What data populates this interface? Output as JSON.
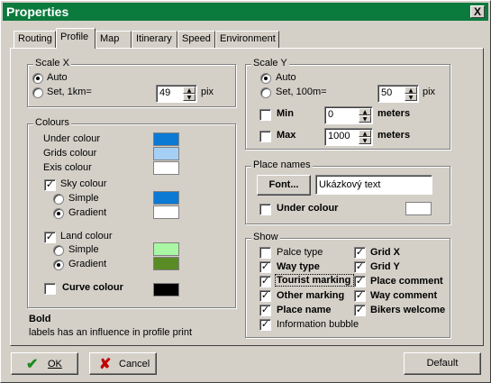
{
  "window": {
    "title": "Properties",
    "close_glyph": "X"
  },
  "tabs": [
    "Routing",
    "Profile",
    "Map",
    "Itinerary",
    "Speed",
    "Environment"
  ],
  "scale_x": {
    "legend": "Scale X",
    "auto_label": "Auto",
    "set_label": "Set, 1km=",
    "value": "49",
    "unit": "pix",
    "selected": "auto"
  },
  "scale_y": {
    "legend": "Scale Y",
    "auto_label": "Auto",
    "set_label": "Set, 100m=",
    "value": "50",
    "unit": "pix",
    "min_label": "Min",
    "min_value": "0",
    "min_unit": "meters",
    "max_label": "Max",
    "max_value": "1000",
    "max_unit": "meters"
  },
  "colours": {
    "legend": "Colours",
    "under": "Under colour",
    "grids": "Grids colour",
    "exis": "Exis colour",
    "sky": "Sky colour",
    "sky_simple": "Simple",
    "sky_gradient": "Gradient",
    "land": "Land colour",
    "land_simple": "Simple",
    "land_gradient": "Gradient",
    "curve": "Curve colour",
    "swatches": {
      "under": "#0a7ad4",
      "grids": "#a6cff5",
      "exis": "#ffffff",
      "sky_simple": "#0a7ad4",
      "sky_gradient": "#ffffff",
      "land_simple": "#a9f7a4",
      "land_gradient": "#5a8c25",
      "curve": "#000000"
    }
  },
  "note": {
    "bold": "Bold",
    "text": "labels has an influence in profile print"
  },
  "place_names": {
    "legend": "Place names",
    "font_button": "Font...",
    "sample": "Ukázkový text",
    "under_label": "Under colour"
  },
  "show": {
    "legend": "Show",
    "left": [
      {
        "label": "Palce type",
        "checked": false,
        "bold": false
      },
      {
        "label": "Way type",
        "checked": true,
        "bold": true
      },
      {
        "label": "Tourist marking",
        "checked": true,
        "bold": true
      },
      {
        "label": "Other marking",
        "checked": true,
        "bold": true
      },
      {
        "label": "Place name",
        "checked": true,
        "bold": true
      },
      {
        "label": "Information bubble",
        "checked": true,
        "bold": false
      }
    ],
    "right": [
      {
        "label": "Grid X",
        "checked": true,
        "bold": true
      },
      {
        "label": "Grid Y",
        "checked": true,
        "bold": true
      },
      {
        "label": "Place comment",
        "checked": true,
        "bold": true
      },
      {
        "label": "Way comment",
        "checked": true,
        "bold": true
      },
      {
        "label": "Bikers welcome",
        "checked": true,
        "bold": true
      }
    ]
  },
  "buttons": {
    "ok": "OK",
    "cancel": "Cancel",
    "default": "Default"
  }
}
